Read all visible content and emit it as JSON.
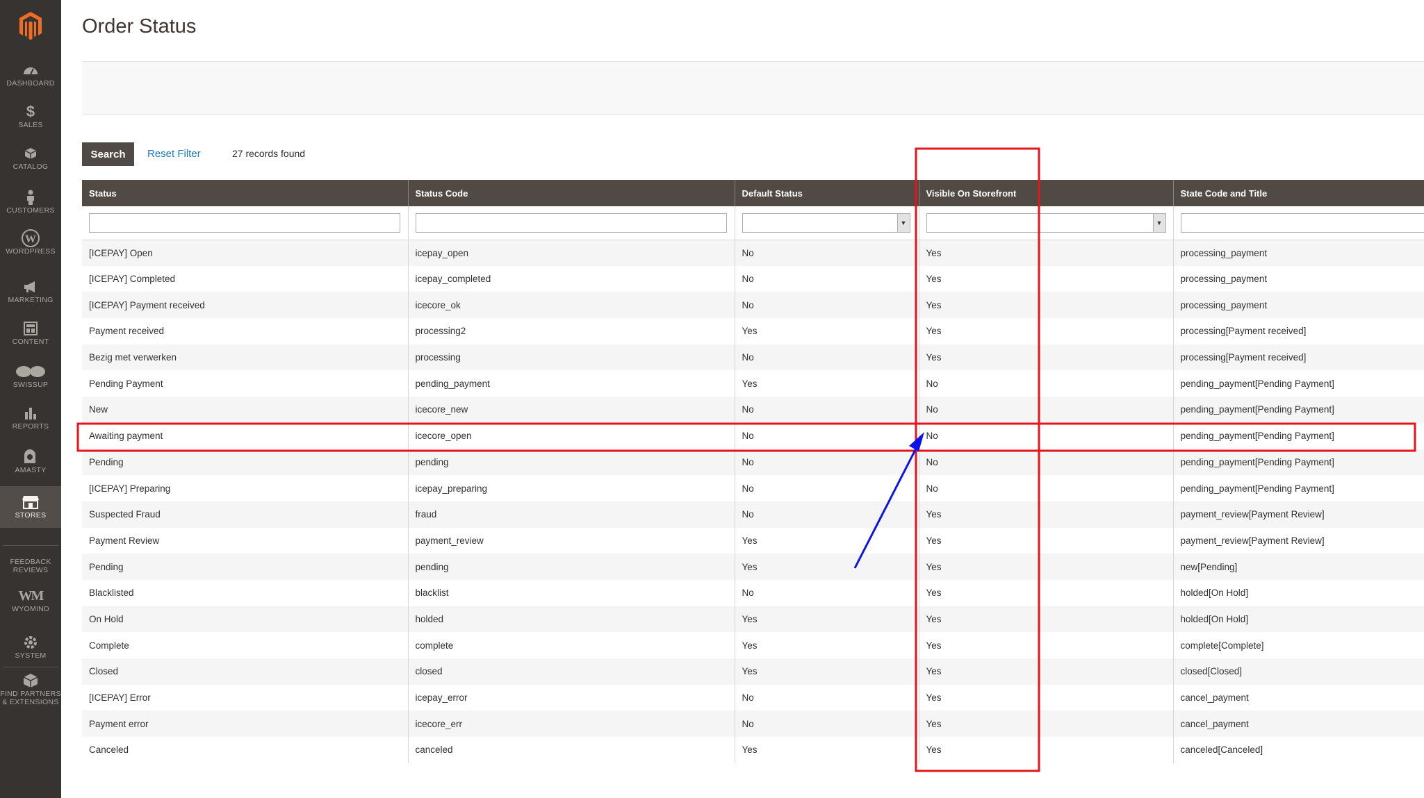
{
  "sidebar": {
    "items": [
      {
        "label": "DASHBOARD",
        "icon": "dashboard-icon"
      },
      {
        "label": "SALES",
        "icon": "dollar-icon"
      },
      {
        "label": "CATALOG",
        "icon": "box-icon"
      },
      {
        "label": "CUSTOMERS",
        "icon": "person-icon"
      },
      {
        "label": "WORDPRESS",
        "icon": "wordpress-icon"
      },
      {
        "label": "MARKETING",
        "icon": "megaphone-icon"
      },
      {
        "label": "CONTENT",
        "icon": "layout-icon"
      },
      {
        "label": "SWISSUP",
        "icon": "swissup-icon"
      },
      {
        "label": "REPORTS",
        "icon": "bar-chart-icon"
      },
      {
        "label": "AMASTY",
        "icon": "amasty-icon"
      },
      {
        "label": "STORES",
        "icon": "store-icon"
      },
      {
        "label": "FEEDBACK REVIEWS",
        "icon": ""
      },
      {
        "label": "WYOMIND",
        "icon": "wyomind-icon"
      },
      {
        "label": "SYSTEM",
        "icon": "gear-icon"
      },
      {
        "label": "FIND PARTNERS & EXTENSIONS",
        "icon": "extensions-icon"
      }
    ]
  },
  "page": {
    "title": "Order Status"
  },
  "toolbar": {
    "search_label": "Search",
    "reset_label": "Reset Filter",
    "records": "27 records found"
  },
  "grid": {
    "columns": [
      "Status",
      "Status Code",
      "Default Status",
      "Visible On Storefront",
      "State Code and Title"
    ],
    "rows": [
      [
        "[ICEPAY] Open",
        "icepay_open",
        "No",
        "Yes",
        "processing_payment"
      ],
      [
        "[ICEPAY] Completed",
        "icepay_completed",
        "No",
        "Yes",
        "processing_payment"
      ],
      [
        "[ICEPAY] Payment received",
        "icecore_ok",
        "No",
        "Yes",
        "processing_payment"
      ],
      [
        "Payment received",
        "processing2",
        "Yes",
        "Yes",
        "processing[Payment received]"
      ],
      [
        "Bezig met verwerken",
        "processing",
        "No",
        "Yes",
        "processing[Payment received]"
      ],
      [
        "Pending Payment",
        "pending_payment",
        "Yes",
        "No",
        "pending_payment[Pending Payment]"
      ],
      [
        "New",
        "icecore_new",
        "No",
        "No",
        "pending_payment[Pending Payment]"
      ],
      [
        "Awaiting payment",
        "icecore_open",
        "No",
        "No",
        "pending_payment[Pending Payment]"
      ],
      [
        "Pending",
        "pending",
        "No",
        "No",
        "pending_payment[Pending Payment]"
      ],
      [
        "[ICEPAY] Preparing",
        "icepay_preparing",
        "No",
        "No",
        "pending_payment[Pending Payment]"
      ],
      [
        "Suspected Fraud",
        "fraud",
        "No",
        "Yes",
        "payment_review[Payment Review]"
      ],
      [
        "Payment Review",
        "payment_review",
        "Yes",
        "Yes",
        "payment_review[Payment Review]"
      ],
      [
        "Pending",
        "pending",
        "Yes",
        "Yes",
        "new[Pending]"
      ],
      [
        "Blacklisted",
        "blacklist",
        "No",
        "Yes",
        "holded[On Hold]"
      ],
      [
        "On Hold",
        "holded",
        "Yes",
        "Yes",
        "holded[On Hold]"
      ],
      [
        "Complete",
        "complete",
        "Yes",
        "Yes",
        "complete[Complete]"
      ],
      [
        "Closed",
        "closed",
        "Yes",
        "Yes",
        "closed[Closed]"
      ],
      [
        "[ICEPAY] Error",
        "icepay_error",
        "No",
        "Yes",
        "cancel_payment"
      ],
      [
        "Payment error",
        "icecore_err",
        "No",
        "Yes",
        "cancel_payment"
      ],
      [
        "Canceled",
        "canceled",
        "Yes",
        "Yes",
        "canceled[Canceled]"
      ]
    ]
  },
  "annotations": {
    "highlight_color": "#e8141c",
    "arrow_color": "#0a14e6"
  }
}
